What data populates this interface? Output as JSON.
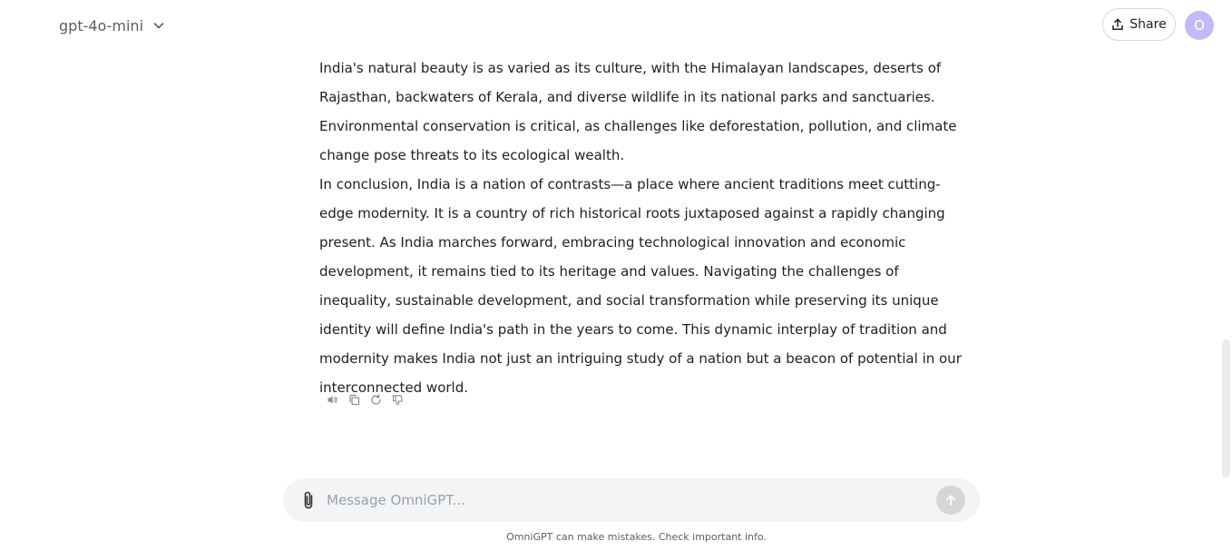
{
  "header": {
    "model_name": "gpt-4o-mini",
    "share_label": "Share",
    "avatar_initial": "O"
  },
  "conversation": {
    "paragraphs": [
      "India's natural beauty is as varied as its culture, with the Himalayan landscapes, deserts of Rajasthan, backwaters of Kerala, and diverse wildlife in its national parks and sanctuaries. Environmental conservation is critical, as challenges like deforestation, pollution, and climate change pose threats to its ecological wealth.",
      "In conclusion, India is a nation of contrasts—a place where ancient traditions meet cutting-edge modernity. It is a country of rich historical roots juxtaposed against a rapidly changing present. As India marches forward, embracing technological innovation and economic development, it remains tied to its heritage and values. Navigating the challenges of inequality, sustainable development, and social transformation while preserving its unique identity will define India's path in the years to come. This dynamic interplay of tradition and modernity makes India not just an intriguing study of a nation but a beacon of potential in our interconnected world."
    ],
    "actions": [
      "speaker-icon",
      "copy-icon",
      "regenerate-icon",
      "thumbs-down-icon"
    ]
  },
  "composer": {
    "placeholder": "Message OmniGPT...",
    "value": ""
  },
  "footer": {
    "note": "OmniGPT can make mistakes. Check important info."
  },
  "colors": {
    "avatar_bg": "#c5b9f5",
    "composer_bg": "#f3f4f6",
    "send_button_bg": "#d5d5d8"
  }
}
